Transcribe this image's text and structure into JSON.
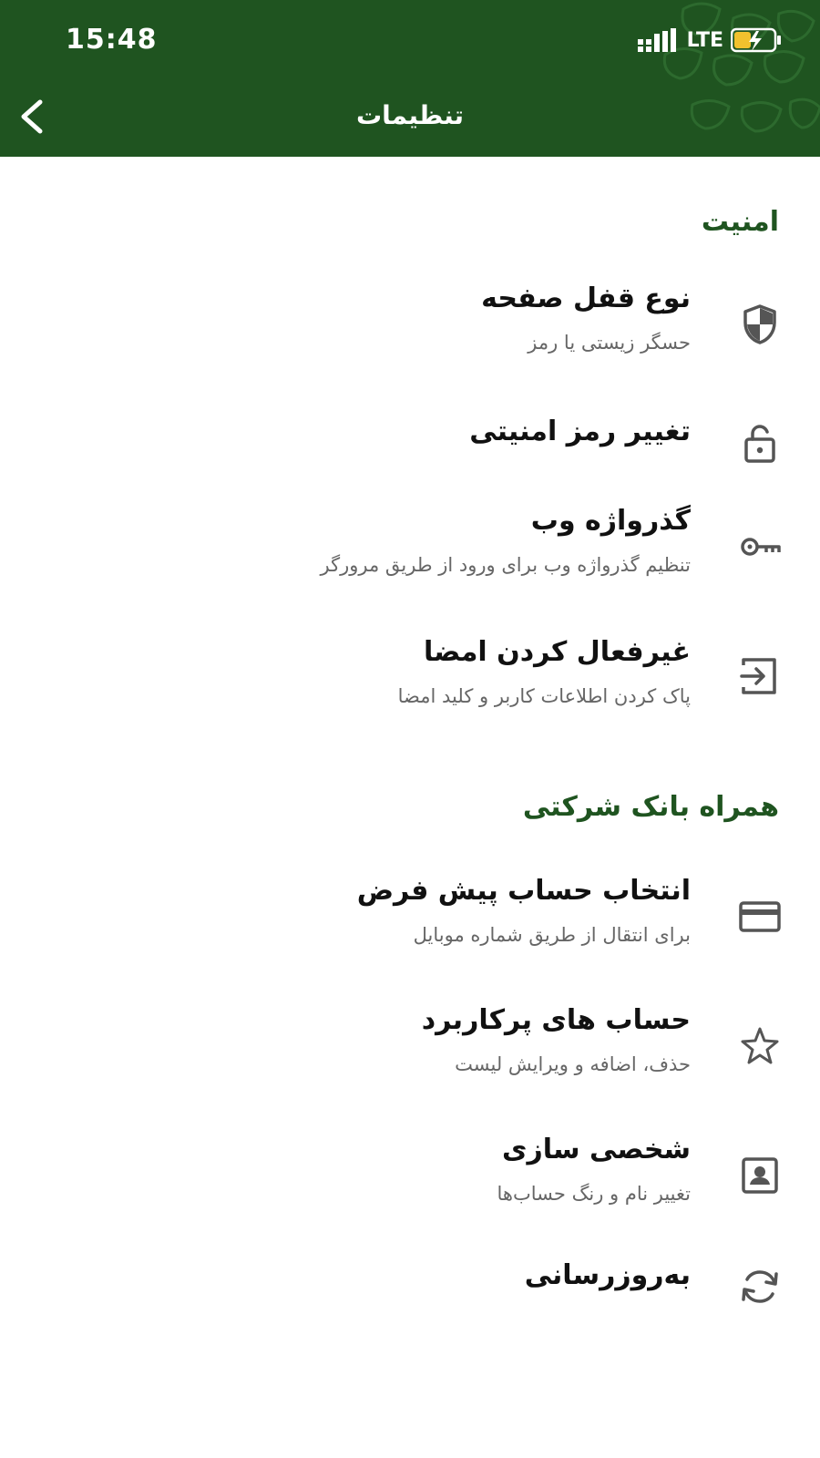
{
  "status_bar": {
    "time": "15:48",
    "network": "LTE"
  },
  "header": {
    "title": "تنظیمات",
    "back_icon": "chevron-left-icon"
  },
  "sections": [
    {
      "title": "امنیت",
      "items": [
        {
          "title": "نوع قفل صفحه",
          "subtitle": "حسگر زیستی یا رمز",
          "icon": "shield-icon"
        },
        {
          "title": "تغییر رمز امنیتی",
          "subtitle": "",
          "icon": "lock-icon"
        },
        {
          "title": "گذرواژه وب",
          "subtitle": "تنظیم گذرواژه وب برای ورود از طریق مرورگر",
          "icon": "key-icon"
        },
        {
          "title": "غیرفعال کردن امضا",
          "subtitle": "پاک کردن اطلاعات کاربر و کلید امضا",
          "icon": "sign-in-icon"
        }
      ]
    },
    {
      "title": "همراه بانک شرکتی",
      "items": [
        {
          "title": "انتخاب حساب پیش فرض",
          "subtitle": "برای انتقال از طریق شماره موبایل",
          "icon": "card-icon"
        },
        {
          "title": "حساب های پرکاربرد",
          "subtitle": "حذف، اضافه و ویرایش لیست",
          "icon": "star-icon"
        },
        {
          "title": "شخصی سازی",
          "subtitle": "تغییر نام و رنگ حساب‌ها",
          "icon": "contact-card-icon"
        },
        {
          "title": "به‌روزرسانی",
          "subtitle": "",
          "icon": "refresh-icon"
        }
      ]
    }
  ],
  "colors": {
    "header_bg": "#1f5420",
    "section_title": "#1f5420",
    "icon_gray": "#555555",
    "battery_yellow": "#f2c12e"
  }
}
